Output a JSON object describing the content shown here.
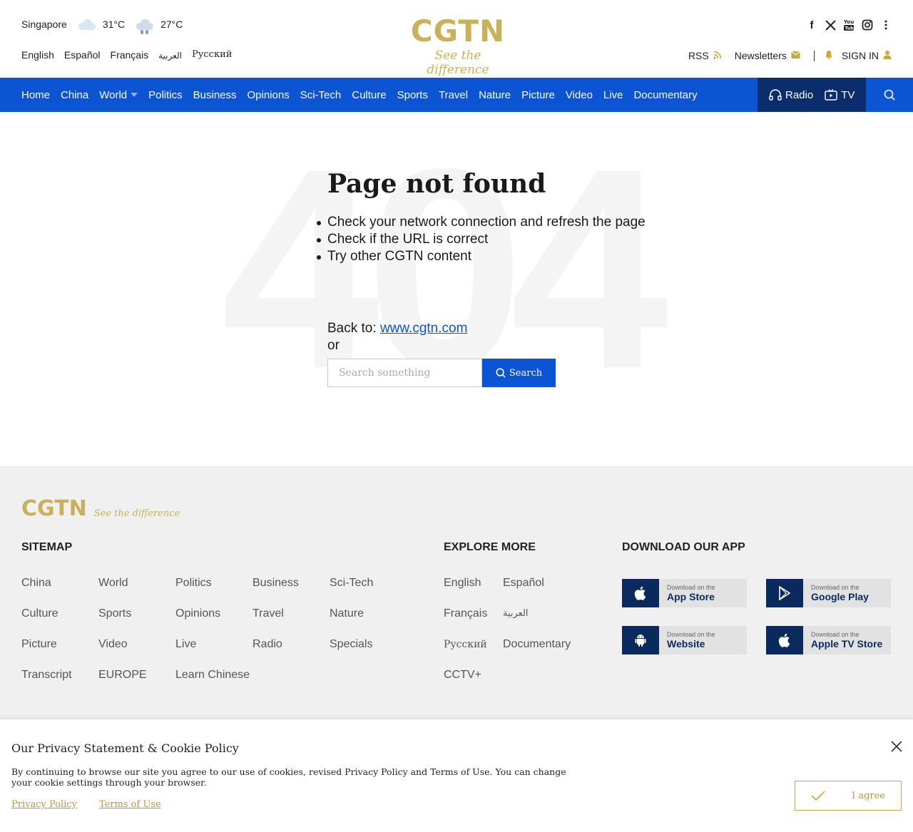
{
  "header": {
    "weather": {
      "city": "Singapore",
      "temp1": "31°C",
      "temp2": "27°C"
    },
    "languages": [
      "English",
      "Español",
      "Français",
      "العربية",
      "Русский"
    ],
    "logo": {
      "brand": "CGTN",
      "slogan": "See the difference"
    },
    "account": {
      "rss": "RSS",
      "newsletters": "Newsletters",
      "sign_in": "SIGN IN"
    }
  },
  "nav": {
    "items": [
      "Home",
      "China",
      "World",
      "Politics",
      "Business",
      "Opinions",
      "Sci-Tech",
      "Culture",
      "Sports",
      "Travel",
      "Nature",
      "Picture",
      "Video",
      "Live",
      "Documentary"
    ],
    "radio": "Radio",
    "tv": "TV"
  },
  "main": {
    "bg_number": "404",
    "title": "Page not found",
    "tips": [
      "Check your network connection and refresh the page",
      "Check if the URL is correct",
      "Try other CGTN content"
    ],
    "back_to": "Back to:",
    "back_link": "www.cgtn.com",
    "or": "or",
    "search_placeholder": "Search something",
    "search_button": "Search"
  },
  "footer": {
    "logo": {
      "brand": "CGTN",
      "slogan": "See the difference"
    },
    "sitemap_title": "SITEMAP",
    "sitemap": [
      "China",
      "World",
      "Politics",
      "Business",
      "Sci-Tech",
      "Culture",
      "Sports",
      "Opinions",
      "Travel",
      "Nature",
      "Picture",
      "Video",
      "Live",
      "Radio",
      "Specials",
      "Transcript",
      "EUROPE",
      "Learn Chinese"
    ],
    "explore_title": "EXPLORE MORE",
    "explore": [
      "English",
      "Español",
      "Français",
      "العربية",
      "Русский",
      "Documentary",
      "CCTV+"
    ],
    "download_title": "DOWNLOAD OUR APP",
    "apps": [
      {
        "small": "Download on the",
        "big": "App Store",
        "icon": "apple-icon"
      },
      {
        "small": "Download on the",
        "big": "Google Play",
        "icon": "google-play-icon"
      },
      {
        "small": "Download on the",
        "big": "Website",
        "icon": "android-icon"
      },
      {
        "small": "Download on the",
        "big": "Apple TV Store",
        "icon": "apple-icon"
      }
    ]
  },
  "cookie": {
    "title": "Our Privacy Statement & Cookie Policy",
    "text": "By continuing to browse our site you agree to our use of cookies, revised Privacy Policy and Terms of Use. You can change your cookie settings through your browser.",
    "privacy_link": "Privacy Policy",
    "terms_link": "Terms of Use",
    "agree": "I agree"
  },
  "colors": {
    "nav_blue": "#0b54d4",
    "nav_dark": "#0b2d6b",
    "gold": "#c9b15a",
    "footer_bg": "#f0f0f0"
  }
}
